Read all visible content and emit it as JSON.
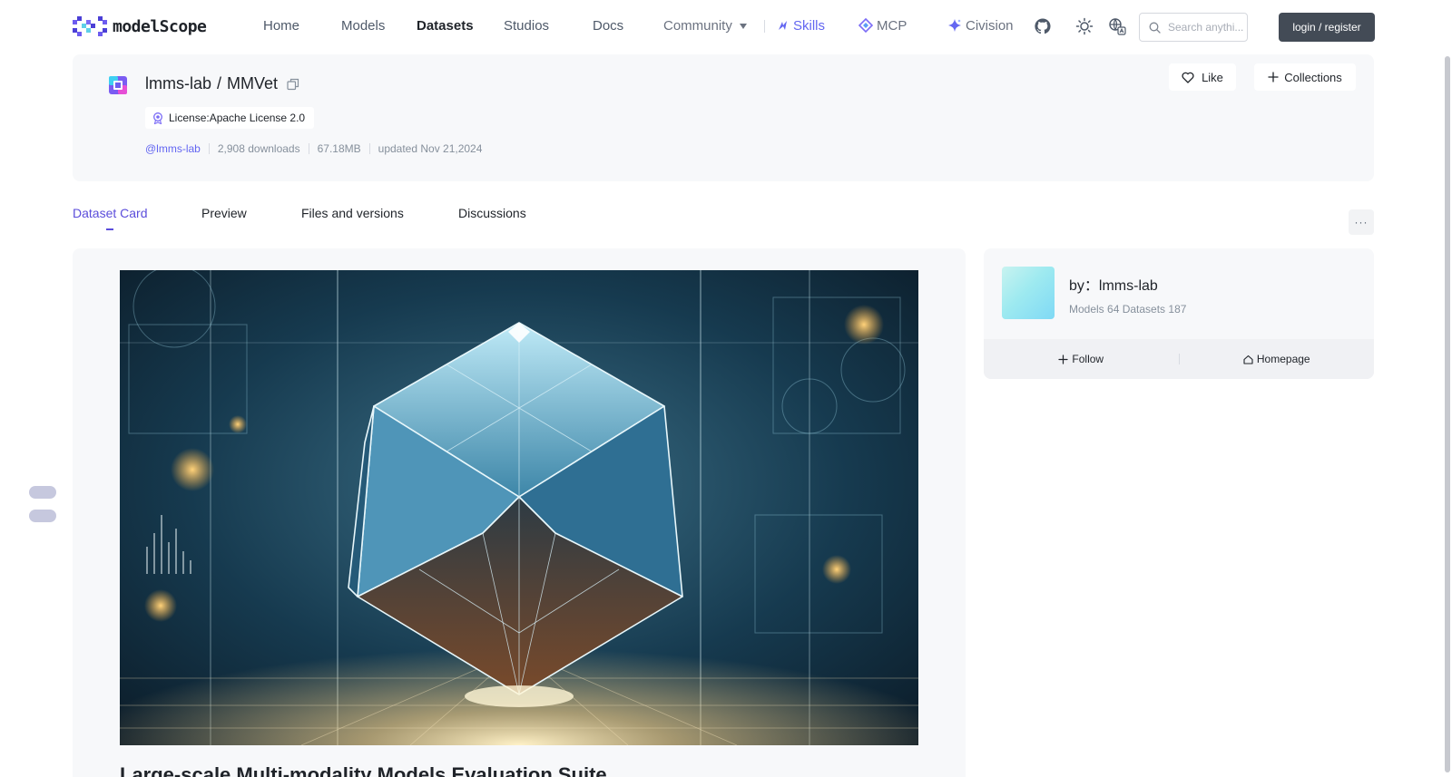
{
  "nav": {
    "logo_text": "modelScope",
    "links": [
      "Home",
      "Models",
      "Datasets",
      "Studios",
      "Docs"
    ],
    "community": "Community",
    "skills": "Skills",
    "mcp": "MCP",
    "civision": "Civision",
    "search_placeholder": "Search anythi...",
    "login": "login / register"
  },
  "header": {
    "owner": "lmms-lab",
    "slash": "/",
    "name": "MMVet",
    "license": "License:Apache License 2.0",
    "meta": {
      "owner_handle": "@lmms-lab",
      "downloads": "2,908 downloads",
      "size": "67.18MB",
      "updated": "updated Nov 21,2024"
    },
    "like": "Like",
    "collections": "Collections"
  },
  "tabs": [
    "Dataset Card",
    "Preview",
    "Files and versions",
    "Discussions"
  ],
  "more": "···",
  "main": {
    "heading": "Large-scale Multi-modality Models Evaluation Suite"
  },
  "owner_card": {
    "by": "by：lmms-lab",
    "stats": "Models 64  Datasets 187",
    "follow": "Follow",
    "homepage": "Homepage"
  },
  "colors": {
    "accent": "#5b4ddb",
    "brand_purple": "#6366f1",
    "login_bg": "#434b56"
  }
}
